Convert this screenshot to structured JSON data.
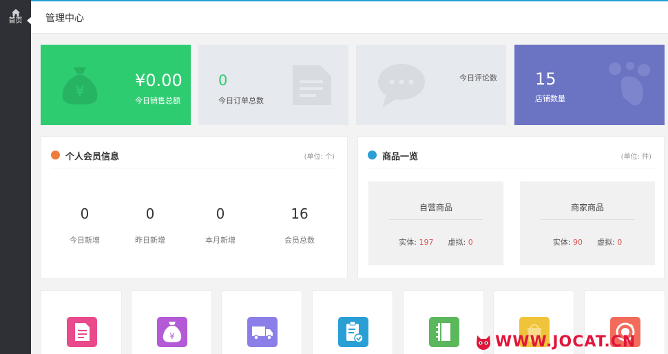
{
  "sidebar": {
    "home_label": "首页"
  },
  "header": {
    "title": "管理中心"
  },
  "stats": [
    {
      "value": "¥0.00",
      "label": "今日销售总额",
      "color": "#2ecc71"
    },
    {
      "value": "0",
      "label": "今日订单总数",
      "color": "#e6e9ed"
    },
    {
      "value": "",
      "label": "今日评论数",
      "color": "#e6e9ed"
    },
    {
      "value": "15",
      "label": "店铺数量",
      "color": "#6b73c3"
    }
  ],
  "members": {
    "title": "个人会员信息",
    "unit": "(单位: 个)",
    "items": [
      {
        "value": "0",
        "label": "今日新增"
      },
      {
        "value": "0",
        "label": "昨日新增"
      },
      {
        "value": "0",
        "label": "本月新增"
      },
      {
        "value": "16",
        "label": "会员总数"
      }
    ]
  },
  "goods": {
    "title": "商品一览",
    "unit": "(单位: 件)",
    "cards": [
      {
        "title": "自营商品",
        "physical_label": "实体:",
        "physical": "197",
        "virtual_label": "虚拟:",
        "virtual": "0"
      },
      {
        "title": "商家商品",
        "physical_label": "实体:",
        "physical": "90",
        "virtual_label": "虚拟:",
        "virtual": "0"
      }
    ]
  },
  "shortcuts": [
    {
      "icon": "document-icon",
      "color": "#e84a8b"
    },
    {
      "icon": "money-bag-icon",
      "color": "#b55ad6"
    },
    {
      "icon": "truck-icon",
      "color": "#8a7ee8"
    },
    {
      "icon": "clipboard-check-icon",
      "color": "#2a9fd6"
    },
    {
      "icon": "notebook-icon",
      "color": "#5cb85c"
    },
    {
      "icon": "bag-icon",
      "color": "#f0c43a"
    },
    {
      "icon": "refund-icon",
      "color": "#f26b5b"
    }
  ],
  "watermark": {
    "text": "WWW.JOCAT.CN"
  },
  "colors": {
    "accent": "#21a1d6",
    "sidebar": "#2f3035",
    "member_icon": "#f07c3c",
    "goods_icon": "#2a9fd6",
    "number_red": "#d9534f"
  }
}
